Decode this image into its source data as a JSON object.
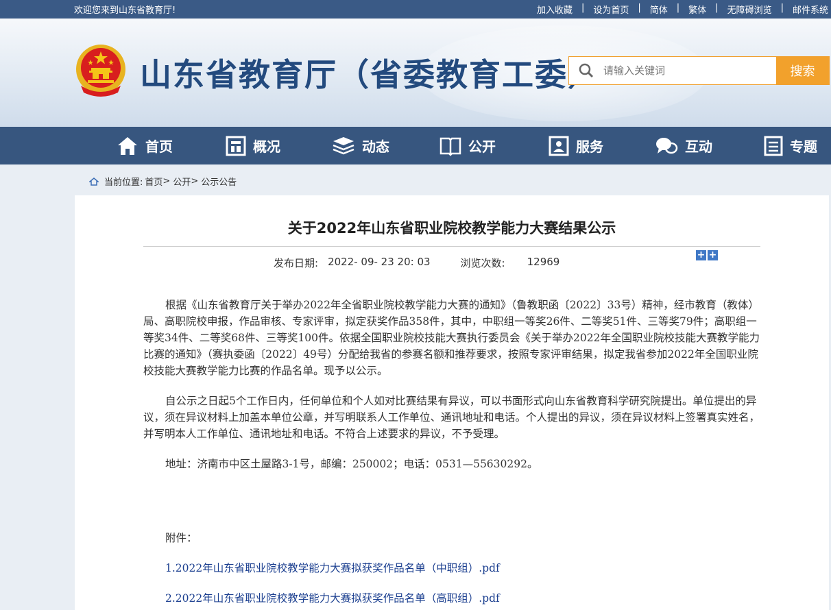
{
  "topbar": {
    "welcome": "欢迎您来到山东省教育厅!",
    "links": [
      "加入收藏",
      "设为首页",
      "简体",
      "繁体",
      "无障碍浏览",
      "邮件系统"
    ],
    "separator": "|"
  },
  "header": {
    "site_title": "山东省教育厅（省委教育工委）",
    "search_placeholder": "请输入关键词",
    "search_button": "搜索"
  },
  "nav": {
    "items": [
      {
        "label": "首页",
        "icon": "home-icon"
      },
      {
        "label": "概况",
        "icon": "building-icon"
      },
      {
        "label": "动态",
        "icon": "stack-icon"
      },
      {
        "label": "公开",
        "icon": "book-icon"
      },
      {
        "label": "服务",
        "icon": "service-icon"
      },
      {
        "label": "互动",
        "icon": "chat-icon"
      },
      {
        "label": "专题",
        "icon": "document-icon"
      }
    ]
  },
  "breadcrumb": {
    "prefix": "当前位置:",
    "items": [
      "首页",
      "公开",
      "公示公告"
    ],
    "separator": ">"
  },
  "article": {
    "title": "关于2022年山东省职业院校教学能力大赛结果公示",
    "date_label": "发布日期:",
    "date_value": "2022- 09- 23 20: 03",
    "views_label": "浏览次数:",
    "views_value": "12969",
    "size_buttons": [
      "+",
      "+"
    ],
    "paragraphs": [
      "根据《山东省教育厅关于举办2022年全省职业院校教学能力大赛的通知》（鲁教职函〔2022〕33号）精神，经市教育（教体）局、高职院校申报，作品审核、专家评审，拟定获奖作品358件，其中，中职组一等奖26件、二等奖51件、三等奖79件；高职组一等奖34件、二等奖68件、三等奖100件。依据全国职业院校技能大赛执行委员会《关于举办2022年全国职业院校技能大赛教学能力比赛的通知》（赛执委函〔2022〕49号）分配给我省的参赛名额和推荐要求，按照专家评审结果，拟定我省参加2022年全国职业院校技能大赛教学能力比赛的作品名单。现予以公示。",
      "自公示之日起5个工作日内，任何单位和个人如对比赛结果有异议，可以书面形式向山东省教育科学研究院提出。单位提出的异议，须在异议材料上加盖本单位公章，并写明联系人工作单位、通讯地址和电话。个人提出的异议，须在异议材料上签署真实姓名，并写明本人工作单位、通讯地址和电话。不符合上述要求的异议，不予受理。",
      "地址：济南市中区土屋路3-1号，邮编：250002；电话：0531—55630292。"
    ],
    "attachments_label": "附件：",
    "attachments": [
      "1.2022年山东省职业院校教学能力大赛拟获奖作品名单（中职组）.pdf",
      "2.2022年山东省职业院校教学能力大赛拟获奖作品名单（高职组）.pdf"
    ]
  },
  "colors": {
    "topbar": "#3a5a86",
    "nav": "#37567f",
    "title_blue": "#234a7e",
    "search_orange": "#f2a12c",
    "link_blue": "#1a3e8f"
  }
}
